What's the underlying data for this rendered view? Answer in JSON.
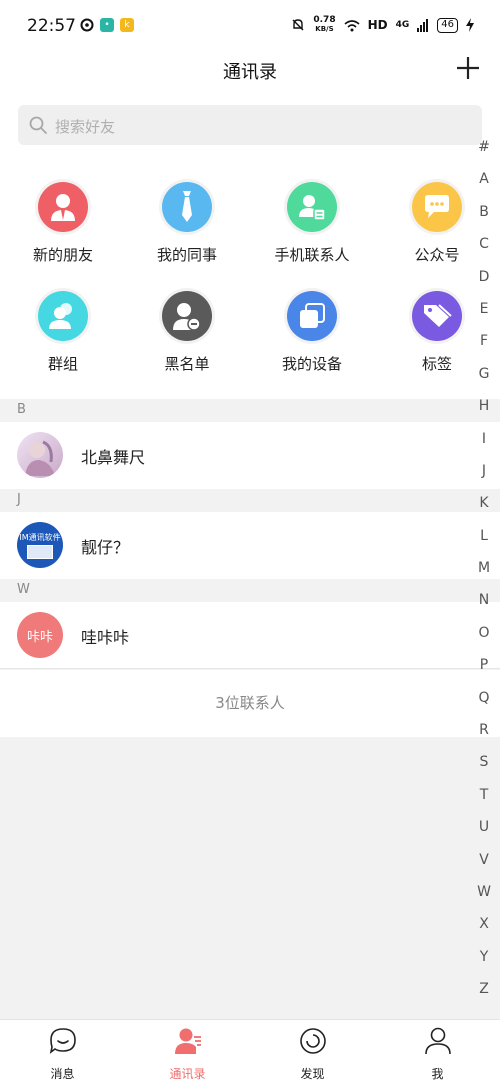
{
  "status": {
    "time": "22:57",
    "net_speed_value": "0.78",
    "net_speed_unit": "KB/S",
    "hd": "HD",
    "network": "4G",
    "battery": "46"
  },
  "header": {
    "title": "通讯录"
  },
  "search": {
    "placeholder": "搜索好友"
  },
  "features": [
    {
      "label": "新的朋友",
      "icon": "new-friend-icon",
      "color": "#ef6066"
    },
    {
      "label": "我的同事",
      "icon": "colleague-tie-icon",
      "color": "#5ab8f0"
    },
    {
      "label": "手机联系人",
      "icon": "phone-contact-icon",
      "color": "#4fd99b"
    },
    {
      "label": "公众号",
      "icon": "official-account-chat-icon",
      "color": "#fbc548"
    },
    {
      "label": "群组",
      "icon": "group-icon",
      "color": "#45d8e2"
    },
    {
      "label": "黑名单",
      "icon": "blacklist-user-icon",
      "color": "#5a5a5a"
    },
    {
      "label": "我的设备",
      "icon": "device-icon",
      "color": "#4a86e8"
    },
    {
      "label": "标签",
      "icon": "tag-icon",
      "color": "#7a5ae0"
    }
  ],
  "sections": [
    {
      "letter": "B",
      "contacts": [
        {
          "name": "北鼻舞尺"
        }
      ]
    },
    {
      "letter": "J",
      "contacts": [
        {
          "name": "靓仔？",
          "avatar_text": "IM通讯软件"
        }
      ]
    },
    {
      "letter": "W",
      "contacts": [
        {
          "name": "哇咔咔",
          "avatar_text": "咔咔"
        }
      ]
    }
  ],
  "contact_count": "3位联系人",
  "index_letters": [
    "#",
    "A",
    "B",
    "C",
    "D",
    "E",
    "F",
    "G",
    "H",
    "I",
    "J",
    "K",
    "L",
    "M",
    "N",
    "O",
    "P",
    "Q",
    "R",
    "S",
    "T",
    "U",
    "V",
    "W",
    "X",
    "Y",
    "Z"
  ],
  "nav": {
    "messages": "消息",
    "contacts": "通讯录",
    "discover": "发现",
    "me": "我",
    "active_color": "#f06e6e"
  }
}
